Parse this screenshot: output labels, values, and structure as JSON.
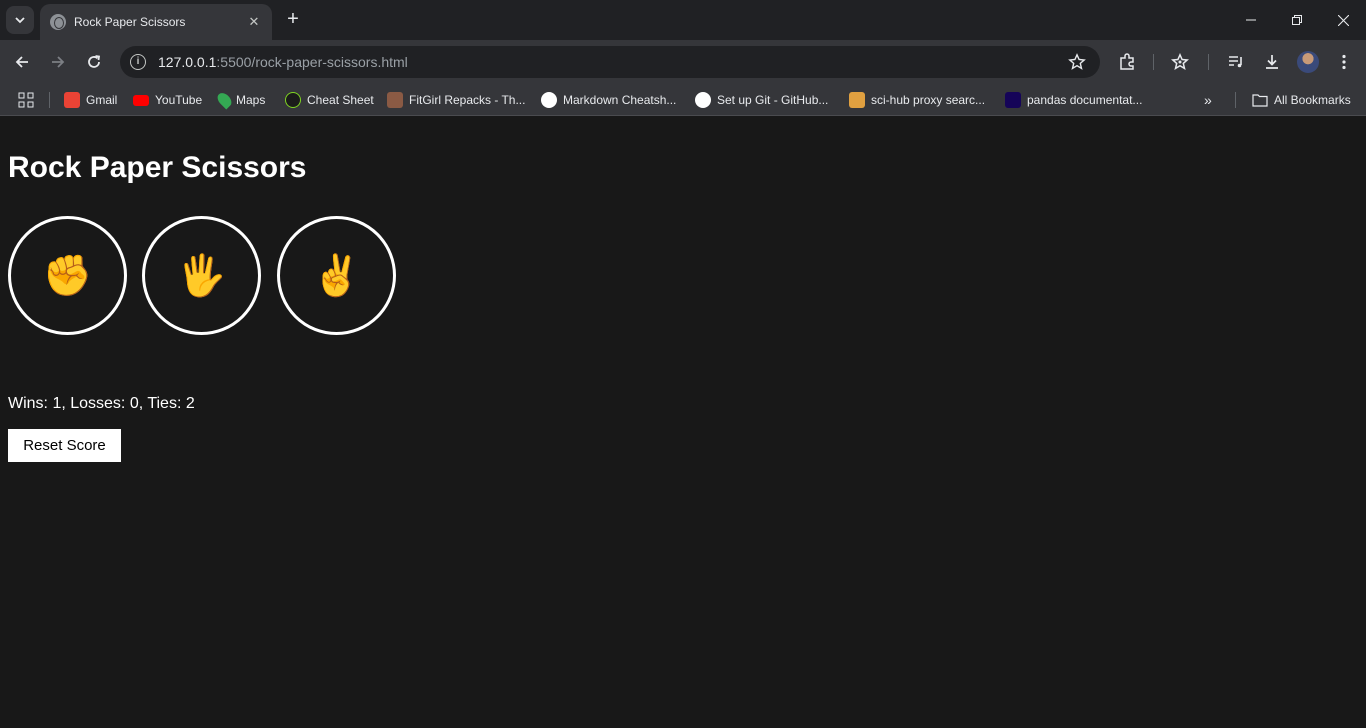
{
  "tab": {
    "title": "Rock Paper Scissors"
  },
  "address_bar": {
    "host": "127.0.0.1",
    "path": ":5500/rock-paper-scissors.html"
  },
  "bookmarks": [
    {
      "label": "Gmail",
      "icon": "gmail-icon",
      "color": "#ea4335"
    },
    {
      "label": "YouTube",
      "icon": "youtube-icon",
      "color": "#ff0000"
    },
    {
      "label": "Maps",
      "icon": "maps-icon",
      "color": "#34a853"
    },
    {
      "label": "Cheat Sheet",
      "icon": "cheat-sheet-icon",
      "color": "#1b1b1b"
    },
    {
      "label": "FitGirl Repacks - Th...",
      "icon": "fitgirl-icon",
      "color": "#8a5a44"
    },
    {
      "label": "Markdown Cheatsh...",
      "icon": "github-icon",
      "color": "#ffffff"
    },
    {
      "label": "Set up Git - GitHub...",
      "icon": "github-icon",
      "color": "#ffffff"
    },
    {
      "label": "sci-hub proxy searc...",
      "icon": "sci-hub-icon",
      "color": "#e0a040"
    },
    {
      "label": "pandas documentat...",
      "icon": "pandas-icon",
      "color": "#150458"
    }
  ],
  "all_bookmarks_label": "All Bookmarks",
  "game": {
    "title": "Rock Paper Scissors",
    "moves": [
      {
        "name": "rock",
        "emoji": "✊"
      },
      {
        "name": "paper",
        "emoji": "🖐"
      },
      {
        "name": "scissors",
        "emoji": "✌"
      }
    ],
    "score_text": "Wins: 1, Losses: 0, Ties: 2",
    "reset_label": "Reset Score"
  }
}
